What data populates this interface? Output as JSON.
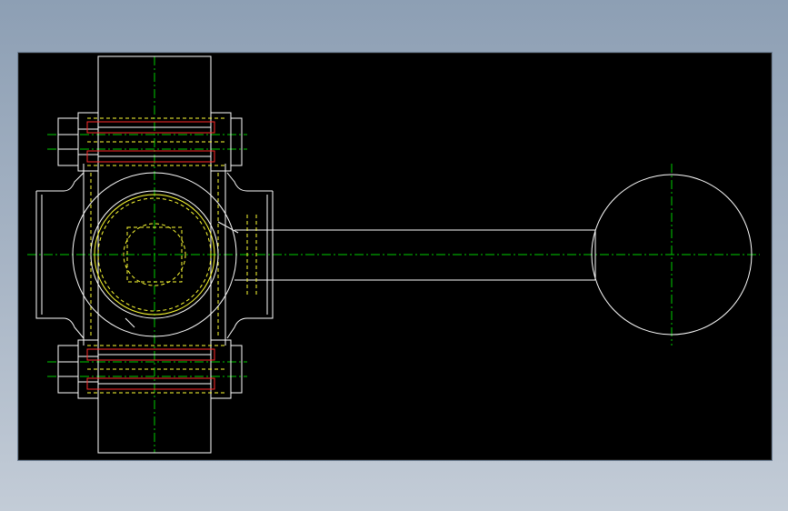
{
  "colors": {
    "background": "#000000",
    "frame": "#8d9fb4",
    "outline": "#ffffff",
    "hidden_lines": "#ffff33",
    "bolt_lines": "#ff2a2a",
    "center_lines": "#00cc00"
  }
}
